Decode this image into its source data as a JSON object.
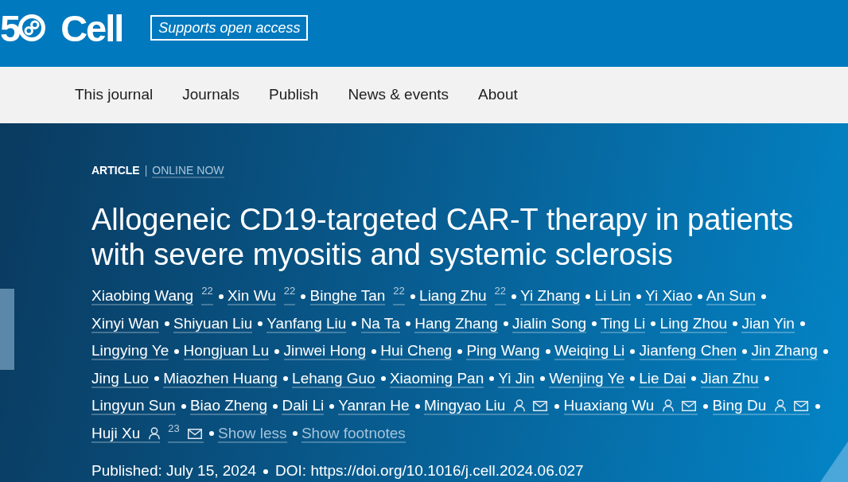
{
  "header": {
    "logo": {
      "digit": "5",
      "wordmark": "Cell"
    },
    "open_access_badge": "Supports open access"
  },
  "nav_items": [
    "This journal",
    "Journals",
    "Publish",
    "News & events",
    "About"
  ],
  "article": {
    "type_label": "ARTICLE",
    "divider": "|",
    "status": "ONLINE NOW",
    "title": "Allogeneic CD19-targeted CAR-T therapy in patients with severe myositis and systemic sclerosis",
    "authors": [
      {
        "name": "Xiaobing Wang",
        "footnote": "22",
        "corresponding": false
      },
      {
        "name": "Xin Wu",
        "footnote": "22",
        "corresponding": false
      },
      {
        "name": "Binghe Tan",
        "footnote": "22",
        "corresponding": false
      },
      {
        "name": "Liang Zhu",
        "footnote": "22",
        "corresponding": false
      },
      {
        "name": "Yi Zhang",
        "corresponding": false
      },
      {
        "name": "Li Lin",
        "corresponding": false
      },
      {
        "name": "Yi Xiao",
        "corresponding": false
      },
      {
        "name": "An Sun",
        "corresponding": false
      },
      {
        "name": "Xinyi Wan",
        "corresponding": false
      },
      {
        "name": "Shiyuan Liu",
        "corresponding": false
      },
      {
        "name": "Yanfang Liu",
        "corresponding": false
      },
      {
        "name": "Na Ta",
        "corresponding": false
      },
      {
        "name": "Hang Zhang",
        "corresponding": false
      },
      {
        "name": "Jialin Song",
        "corresponding": false
      },
      {
        "name": "Ting Li",
        "corresponding": false
      },
      {
        "name": "Ling Zhou",
        "corresponding": false
      },
      {
        "name": "Jian Yin",
        "corresponding": false
      },
      {
        "name": "Lingying Ye",
        "corresponding": false
      },
      {
        "name": "Hongjuan Lu",
        "corresponding": false
      },
      {
        "name": "Jinwei Hong",
        "corresponding": false
      },
      {
        "name": "Hui Cheng",
        "corresponding": false
      },
      {
        "name": "Ping Wang",
        "corresponding": false
      },
      {
        "name": "Weiqing Li",
        "corresponding": false
      },
      {
        "name": "Jianfeng Chen",
        "corresponding": false
      },
      {
        "name": "Jin Zhang",
        "corresponding": false
      },
      {
        "name": "Jing Luo",
        "corresponding": false
      },
      {
        "name": "Miaozhen Huang",
        "corresponding": false
      },
      {
        "name": "Lehang Guo",
        "corresponding": false
      },
      {
        "name": "Xiaoming Pan",
        "corresponding": false
      },
      {
        "name": "Yi Jin",
        "corresponding": false
      },
      {
        "name": "Wenjing Ye",
        "corresponding": false
      },
      {
        "name": "Lie Dai",
        "corresponding": false
      },
      {
        "name": "Jian Zhu",
        "corresponding": false
      },
      {
        "name": "Lingyun Sun",
        "corresponding": false
      },
      {
        "name": "Biao Zheng",
        "corresponding": false
      },
      {
        "name": "Dali Li",
        "corresponding": false
      },
      {
        "name": "Yanran He",
        "corresponding": false
      },
      {
        "name": "Mingyao Liu",
        "corresponding": true
      },
      {
        "name": "Huaxiang Wu",
        "corresponding": true
      },
      {
        "name": "Bing Du",
        "corresponding": true
      },
      {
        "name": "Huji Xu",
        "footnote": "23",
        "corresponding": true
      }
    ],
    "author_links": [
      "Show less",
      "Show footnotes"
    ],
    "published": "Published: July 15, 2024",
    "doi": "DOI: https://doi.org/10.1016/j.cell.2024.06.027"
  }
}
